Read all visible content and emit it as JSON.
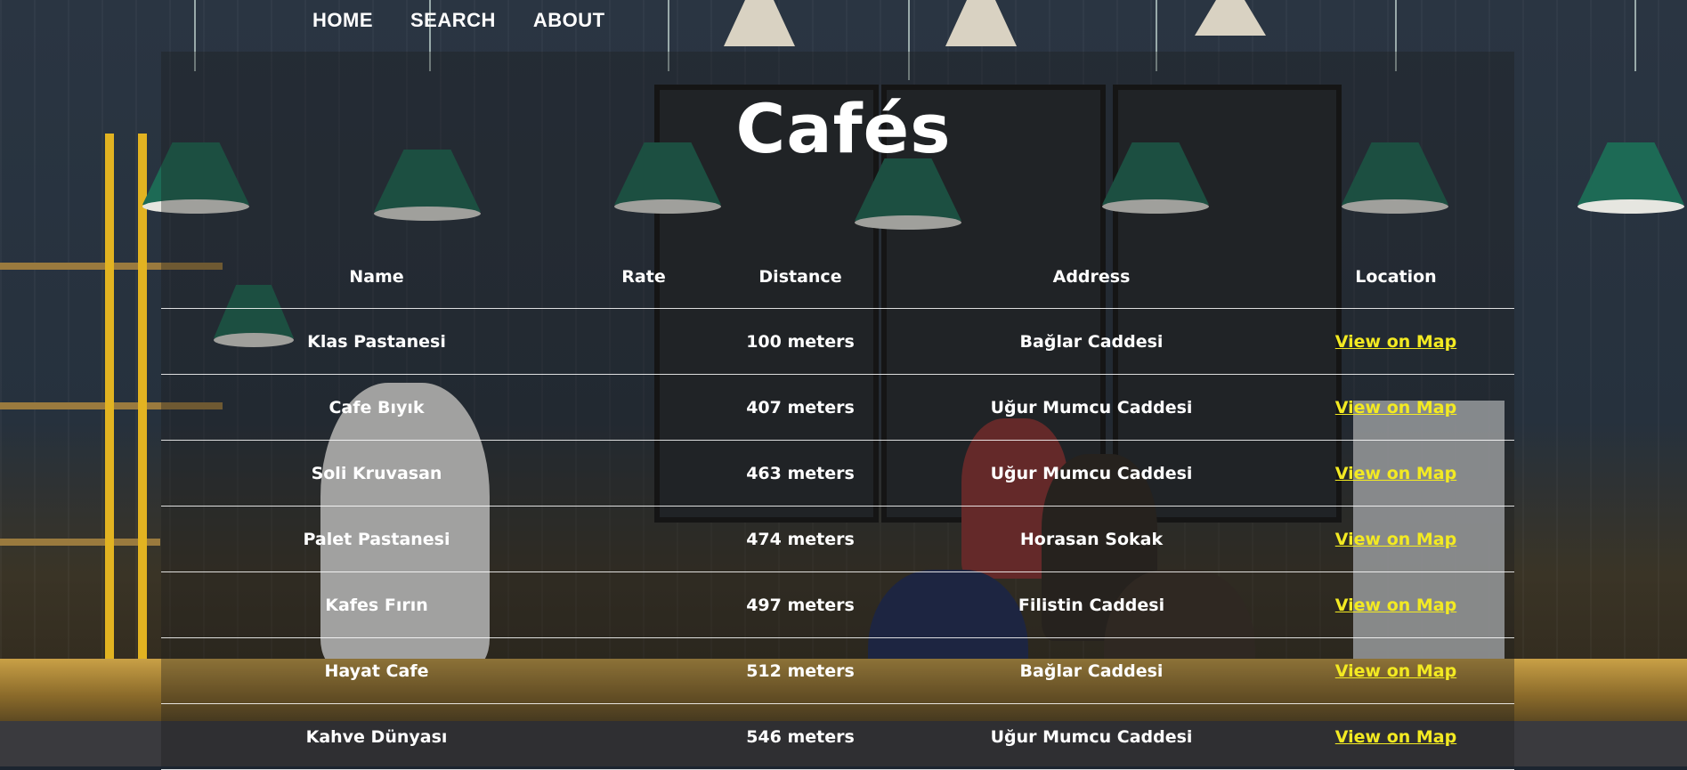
{
  "nav": {
    "home": "HOME",
    "search": "SEARCH",
    "about": "ABOUT"
  },
  "page_title": "Cafés",
  "table": {
    "headers": {
      "name": "Name",
      "rate": "Rate",
      "distance": "Distance",
      "address": "Address",
      "location": "Location"
    },
    "rows": [
      {
        "name": "Klas Pastanesi",
        "rate": "",
        "distance": "100 meters",
        "address": "Bağlar Caddesi",
        "location": "View on Map"
      },
      {
        "name": "Cafe Bıyık",
        "rate": "",
        "distance": "407 meters",
        "address": "Uğur Mumcu Caddesi",
        "location": "View on Map"
      },
      {
        "name": "Soli Kruvasan",
        "rate": "",
        "distance": "463 meters",
        "address": "Uğur Mumcu Caddesi",
        "location": "View on Map"
      },
      {
        "name": "Palet Pastanesi",
        "rate": "",
        "distance": "474 meters",
        "address": "Horasan Sokak",
        "location": "View on Map"
      },
      {
        "name": "Kafes Fırın",
        "rate": "",
        "distance": "497 meters",
        "address": "Filistin Caddesi",
        "location": "View on Map"
      },
      {
        "name": "Hayat Cafe",
        "rate": "",
        "distance": "512 meters",
        "address": "Bağlar Caddesi",
        "location": "View on Map"
      },
      {
        "name": "Kahve Dünyası",
        "rate": "",
        "distance": "546 meters",
        "address": "Uğur Mumcu Caddesi",
        "location": "View on Map"
      }
    ]
  },
  "colors": {
    "link": "#f3ea22",
    "text": "#ffffff",
    "lamp": "#1d6a55"
  }
}
